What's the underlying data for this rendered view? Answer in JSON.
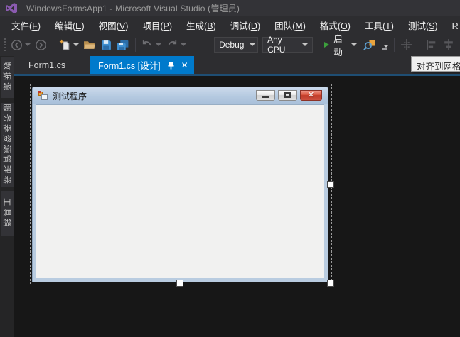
{
  "window": {
    "title": "WindowsFormsApp1 - Microsoft Visual Studio (管理员)"
  },
  "menu": {
    "items": [
      {
        "pre": "文件(",
        "key": "F",
        "post": ")"
      },
      {
        "pre": "编辑(",
        "key": "E",
        "post": ")"
      },
      {
        "pre": "视图(",
        "key": "V",
        "post": ")"
      },
      {
        "pre": "项目(",
        "key": "P",
        "post": ")"
      },
      {
        "pre": "生成(",
        "key": "B",
        "post": ")"
      },
      {
        "pre": "调试(",
        "key": "D",
        "post": ")"
      },
      {
        "pre": "团队(",
        "key": "M",
        "post": ")"
      },
      {
        "pre": "格式(",
        "key": "O",
        "post": ")"
      },
      {
        "pre": "工具(",
        "key": "T",
        "post": ")"
      },
      {
        "pre": "测试(",
        "key": "S",
        "post": ")"
      },
      {
        "pre": "R 工具",
        "key": "",
        "post": ""
      }
    ]
  },
  "toolbar": {
    "config": "Debug",
    "platform": "Any CPU",
    "start": "启动"
  },
  "tabs": {
    "items": [
      {
        "label": "Form1.cs"
      },
      {
        "label": "Form1.cs [设计]"
      }
    ]
  },
  "sidebar": {
    "items": [
      {
        "label": "数据源"
      },
      {
        "label": "服务器资源管理器"
      },
      {
        "label": "工具箱"
      }
    ]
  },
  "designer": {
    "form_title": "测试程序"
  },
  "tooltip": {
    "text": "对齐到网格"
  },
  "icons": {
    "tab_close": "✕",
    "form_close": "✕"
  },
  "colors": {
    "accent": "#007ACC",
    "chrome": "#2D2D30",
    "editor_bg": "#171717",
    "tab_underline": "#1F4E73",
    "form_frame": "#B9CCE0",
    "form_client": "#F1F1F0",
    "close_red": "#C03A28",
    "start_green": "#3CA03C",
    "folder_tan": "#DCB67A",
    "save_blue": "#3E8FD0"
  }
}
